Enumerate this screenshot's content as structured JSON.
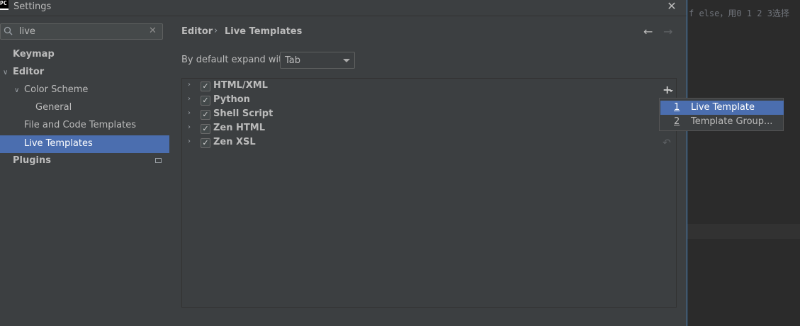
{
  "window": {
    "title": "Settings",
    "logo_text": "PC"
  },
  "background_editor": {
    "code_snippet": "f else，用0 1 2 3选择"
  },
  "search": {
    "value": "live"
  },
  "sidebar": {
    "items": [
      {
        "label": "Keymap"
      },
      {
        "label": "Editor"
      },
      {
        "label": "Color Scheme"
      },
      {
        "label": "General"
      },
      {
        "label": "File and Code Templates"
      },
      {
        "label": "Live Templates"
      },
      {
        "label": "Plugins"
      }
    ]
  },
  "breadcrumb": {
    "parent": "Editor",
    "separator": "›",
    "current": "Live Templates"
  },
  "expand": {
    "label": "By default expand with",
    "value": "Tab"
  },
  "template_groups": [
    {
      "label": "HTML/XML",
      "checked": true
    },
    {
      "label": "Python",
      "checked": true
    },
    {
      "label": "Shell Script",
      "checked": true
    },
    {
      "label": "Zen HTML",
      "checked": true
    },
    {
      "label": "Zen XSL",
      "checked": true
    }
  ],
  "add_menu": {
    "items": [
      {
        "number": "1",
        "label": "Live Template"
      },
      {
        "number": "2",
        "label": "Template Group..."
      }
    ]
  },
  "colors": {
    "accent": "#4b6eaf",
    "panel": "#3c3f41",
    "focus_border": "#4a88c7"
  },
  "icons": [
    "search-icon",
    "close-icon",
    "chevron-right-icon",
    "chevron-down-icon",
    "back-arrow-icon",
    "forward-arrow-icon",
    "add-icon",
    "undo-icon",
    "checkbox-icon"
  ]
}
